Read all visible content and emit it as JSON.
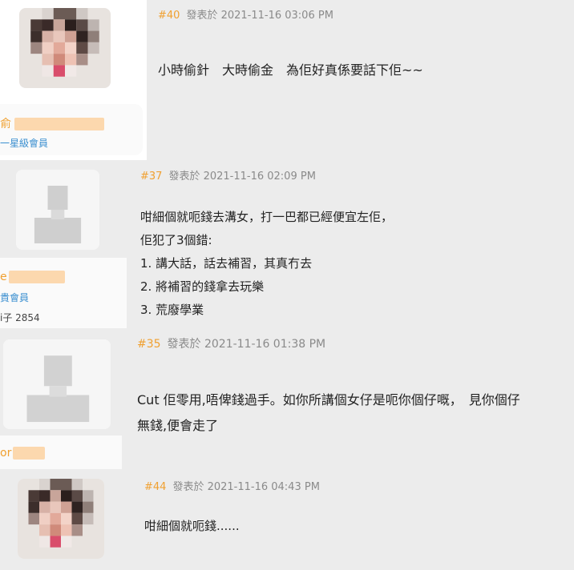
{
  "posts": [
    {
      "number": "#40",
      "meta": "發表於 2021-11-16 03:06 PM",
      "lines": [
        "小時偷針　大時偷金　為佢好真係要話下佢~~"
      ],
      "user_name_fragment": "俞",
      "rank": "一星級會員"
    },
    {
      "number": "#37",
      "meta": "發表於 2021-11-16 02:09 PM",
      "lines": [
        "咁細個就呃錢去溝女，打一巴都已經便宜左佢，",
        "佢犯了3個錯:",
        "1.  講大話，話去補習，其真冇去",
        "2.  將補習的錢拿去玩樂",
        "3.  荒廢學業"
      ],
      "user_name_fragment": "e",
      "rank": "貴會員",
      "stat": "i子  2854"
    },
    {
      "number": "#35",
      "meta": "發表於 2021-11-16 01:38 PM",
      "lines": [
        "Cut  佢零用,唔俾錢過手。如你所講個女仔是呃你個仔嘅，　見你個仔",
        "無錢,便會走了"
      ],
      "user_name_fragment": "or"
    },
    {
      "number": "#44",
      "meta": "發表於 2021-11-16 04:43 PM",
      "lines": [
        "咁細個就呃錢......"
      ]
    }
  ],
  "colors": {
    "accent": "#f0a030",
    "rank": "#3a8fd0",
    "panel": "#ececec",
    "card": "#fafafa"
  }
}
